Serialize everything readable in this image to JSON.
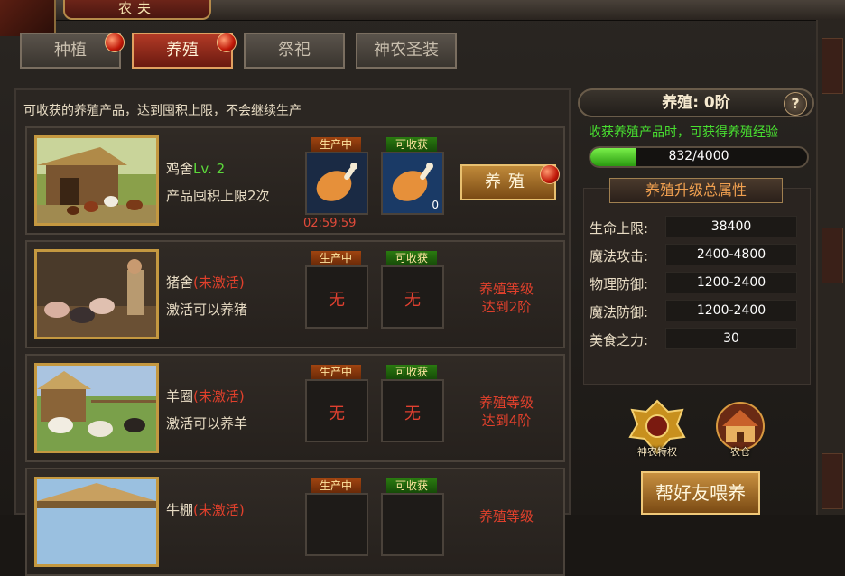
{
  "window": {
    "title": "农夫"
  },
  "tabs": [
    {
      "label": "种植",
      "active": false,
      "badge": true
    },
    {
      "label": "养殖",
      "active": true,
      "badge": true
    },
    {
      "label": "祭祀",
      "active": false,
      "badge": false
    },
    {
      "label": "神农圣装",
      "active": false,
      "badge": false
    }
  ],
  "notice": "可收获的养殖产品，达到囤积上限，不会继续生产",
  "slot_labels": {
    "producing": "生产中",
    "harvestable": "可收获"
  },
  "farms": [
    {
      "name": "鸡舍",
      "level": "Lv. 2",
      "inactive": "",
      "sub": "产品囤积上限2次",
      "producing": "",
      "harvest_count": "0",
      "timer": "02:59:59",
      "action": "养殖",
      "requirement": [],
      "image": "chicken-coop"
    },
    {
      "name": "猪舍",
      "level": "",
      "inactive": "(未激活)",
      "sub": "激活可以养猪",
      "producing": "无",
      "harvest": "无",
      "timer": "",
      "action": "",
      "requirement": [
        "养殖等级",
        "达到2阶"
      ],
      "image": "pig-pen"
    },
    {
      "name": "羊圈",
      "level": "",
      "inactive": "(未激活)",
      "sub": "激活可以养羊",
      "producing": "无",
      "harvest": "无",
      "timer": "",
      "action": "",
      "requirement": [
        "养殖等级",
        "达到4阶"
      ],
      "image": "sheep-pen"
    },
    {
      "name": "牛棚",
      "level": "",
      "inactive": "(未激活)",
      "sub": "",
      "producing": "",
      "harvest": "",
      "timer": "",
      "action": "",
      "requirement": [
        "养殖等级",
        ""
      ],
      "image": "cow-shed"
    }
  ],
  "level_panel": {
    "title": "养殖: 0阶",
    "help": "?",
    "hint": "收获养殖产品时，可获得养殖经验",
    "xp_text": "832/4000",
    "xp_fraction": 0.208
  },
  "attributes": {
    "header": "养殖升级总属性",
    "items": [
      {
        "key": "生命上限:",
        "value": "38400"
      },
      {
        "key": "魔法攻击:",
        "value": "2400-4800"
      },
      {
        "key": "物理防御:",
        "value": "1200-2400"
      },
      {
        "key": "魔法防御:",
        "value": "1200-2400"
      },
      {
        "key": "美食之力:",
        "value": "30"
      }
    ]
  },
  "badges": [
    {
      "label": "神农特权",
      "icon": "shennong-privilege-icon"
    },
    {
      "label": "农仓",
      "icon": "granary-icon"
    }
  ],
  "friend_button": "帮好友喂养",
  "colors": {
    "accent_red": "#b23a26",
    "gold": "#c49840",
    "green": "#48e030",
    "warning": "#e0402c"
  }
}
